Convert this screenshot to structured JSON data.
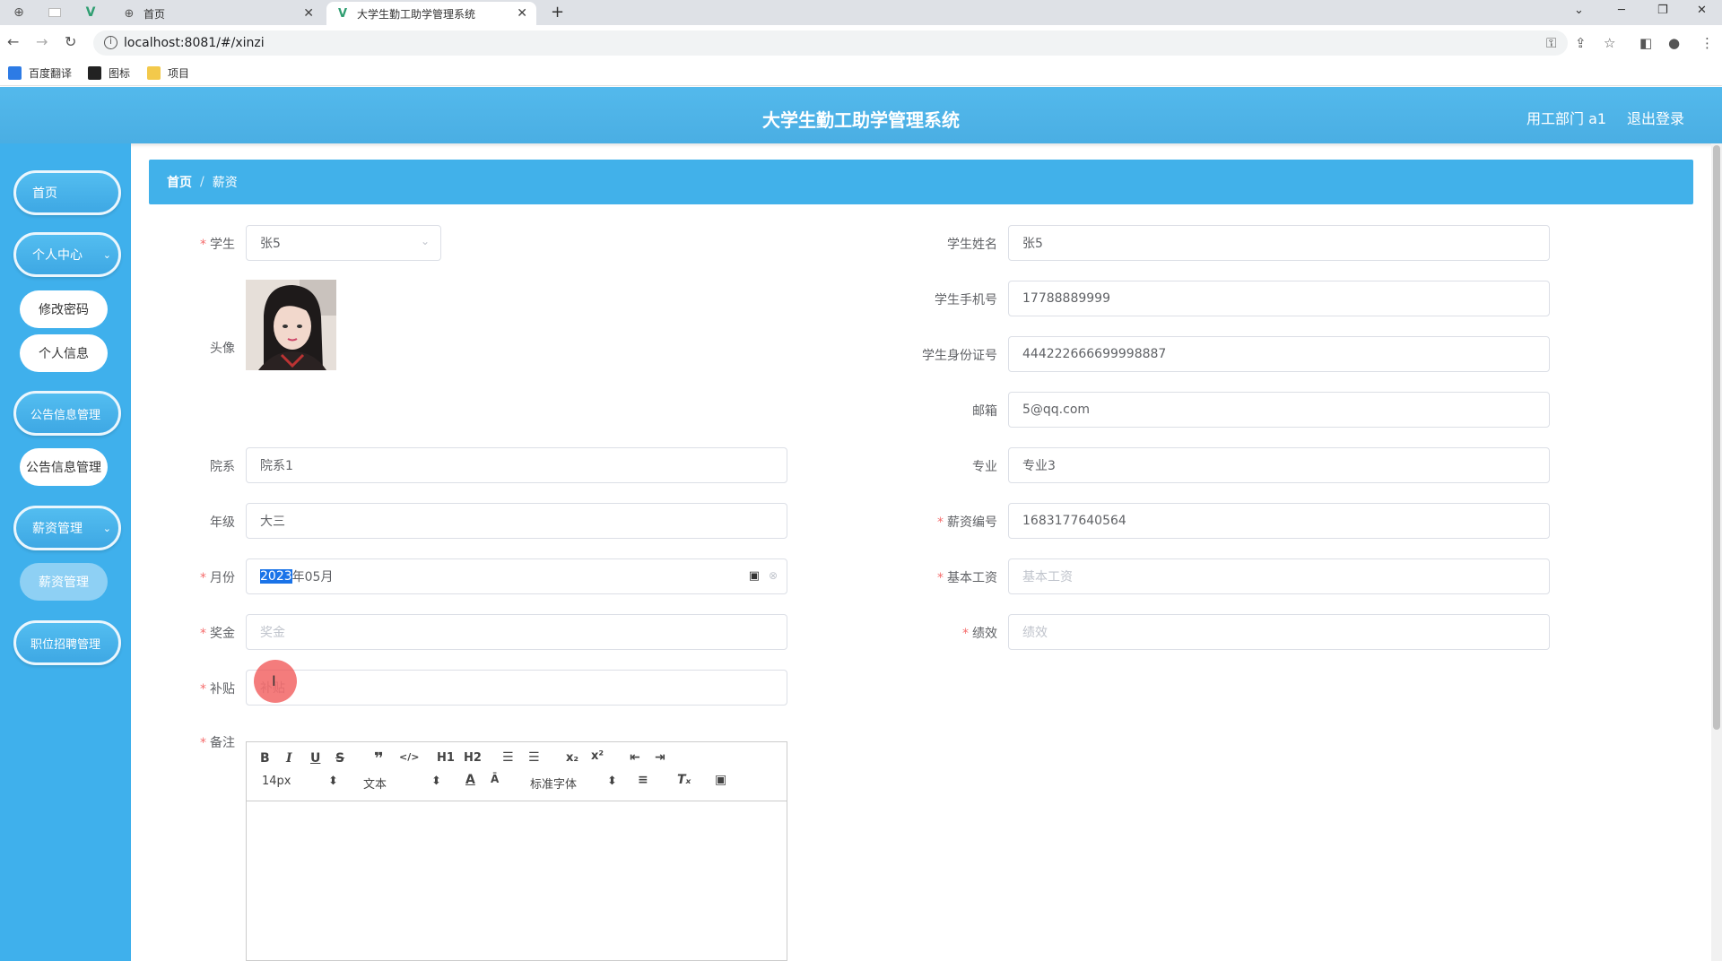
{
  "browser": {
    "tabs": [
      {
        "title": "首页"
      },
      {
        "title": "大学生勤工助学管理系统"
      }
    ],
    "url": "localhost:8081/#/xinzi",
    "bookmarks": [
      {
        "label": "百度翻译",
        "icon": "translate-icon"
      },
      {
        "label": "图标",
        "icon": "flag-icon"
      },
      {
        "label": "项目",
        "icon": "folder-icon"
      }
    ]
  },
  "app": {
    "title": "大学生勤工助学管理系统",
    "user": "用工部门 a1",
    "logout": "退出登录",
    "colors": {
      "header": "#4aaee3",
      "sidebar": "#3fb0ec",
      "breadcrumb": "#41b1ea",
      "required": "#f56c6c"
    }
  },
  "sidebar": {
    "home": "首页",
    "personal": "个人中心",
    "change_password": "修改密码",
    "personal_info": "个人信息",
    "notice_mgmt": "公告信息管理",
    "notice_sub": "公告信息管理",
    "salary_mgmt": "薪资管理",
    "salary_sub": "薪资管理",
    "job_mgmt": "职位招聘管理"
  },
  "breadcrumb": {
    "home": "首页",
    "separator": "/",
    "current": "薪资"
  },
  "form": {
    "student": {
      "label": "学生",
      "value": "张5"
    },
    "avatar": {
      "label": "头像"
    },
    "department": {
      "label": "院系",
      "value": "院系1"
    },
    "grade": {
      "label": "年级",
      "value": "大三"
    },
    "month": {
      "label": "月份",
      "value_selected": "2023",
      "value_rest": "年05月"
    },
    "bonus": {
      "label": "奖金",
      "placeholder": "奖金"
    },
    "subsidy": {
      "label": "补贴",
      "placeholder": "补贴"
    },
    "remark": {
      "label": "备注"
    },
    "student_name": {
      "label": "学生姓名",
      "value": "张5"
    },
    "phone": {
      "label": "学生手机号",
      "value": "17788889999"
    },
    "id_card": {
      "label": "学生身份证号",
      "value": "444222666699998887"
    },
    "email": {
      "label": "邮箱",
      "value": "5@qq.com"
    },
    "major": {
      "label": "专业",
      "value": "专业3"
    },
    "salary_no": {
      "label": "薪资编号",
      "value": "1683177640564"
    },
    "base_salary": {
      "label": "基本工资",
      "placeholder": "基本工资"
    },
    "performance": {
      "label": "绩效",
      "placeholder": "绩效"
    }
  },
  "editor": {
    "font_size": "14px",
    "block_type": "文本",
    "font_family": "标准字体",
    "h1": "H1",
    "h2": "H2"
  }
}
